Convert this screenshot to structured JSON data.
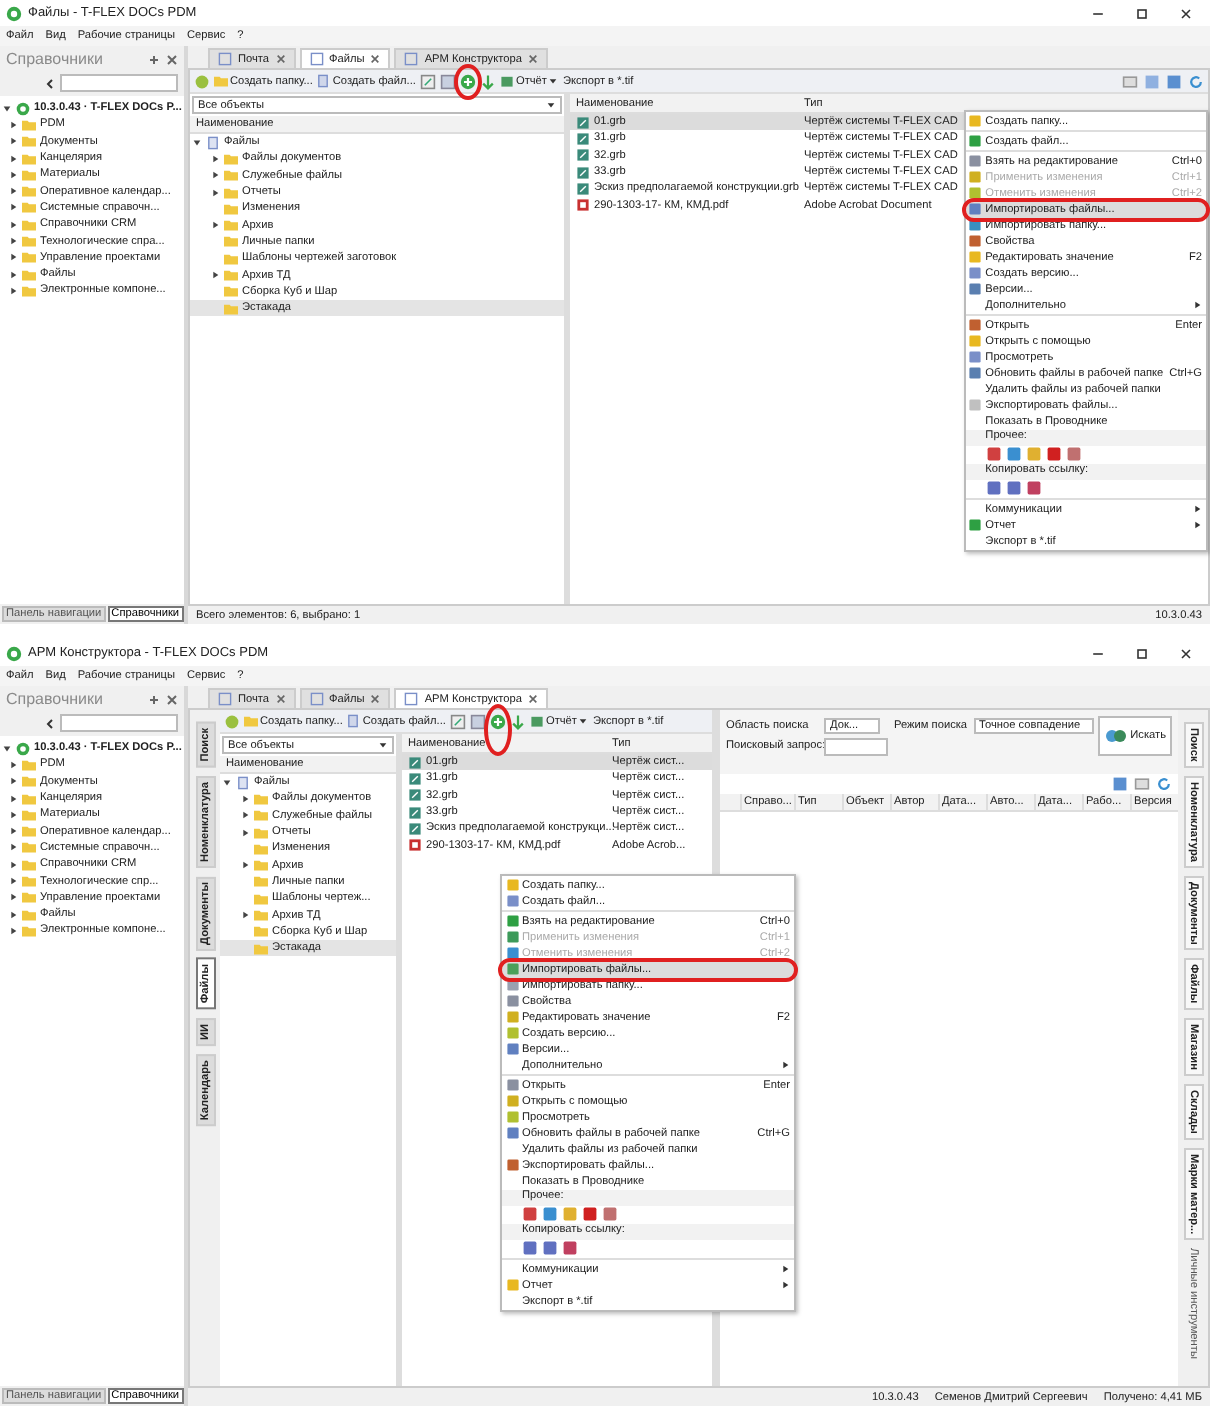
{
  "screens": [
    {
      "title": "Файлы - T-FLEX DOCs PDM",
      "menu": [
        "Файл",
        "Вид",
        "Рабочие страницы",
        "Сервис",
        "?"
      ],
      "nav": {
        "title": "Справочники",
        "root": "10.3.0.43 · T-FLEX DOCs P...",
        "items": [
          "PDM",
          "Документы",
          "Канцелярия",
          "Материалы",
          "Оперативное календар...",
          "Системные справочн...",
          "Справочники CRM",
          "Технологические спра...",
          "Управление проектами",
          "Файлы",
          "Электронные компоне..."
        ],
        "bottom_tabs": [
          {
            "label": "Панель навигации",
            "selected": false
          },
          {
            "label": "Справочники",
            "selected": true
          }
        ]
      },
      "tabs": [
        {
          "label": "Почта",
          "selected": false
        },
        {
          "label": "Файлы",
          "selected": true
        },
        {
          "label": "АРМ Конструктора",
          "selected": false
        }
      ],
      "toolbar": {
        "create_folder": "Создать папку...",
        "create_file": "Создать файл...",
        "report": "Отчёт",
        "export": "Экспорт в *.tif",
        "import_annotated": true
      },
      "filter": "Все объекты",
      "tree": {
        "column": "Наименование",
        "root": "Файлы",
        "children": [
          {
            "label": "Файлы документов",
            "expandable": true,
            "selected": false
          },
          {
            "label": "Служебные файлы",
            "expandable": true,
            "selected": false
          },
          {
            "label": "Отчеты",
            "expandable": true,
            "selected": false
          },
          {
            "label": "Изменения",
            "expandable": false,
            "selected": false
          },
          {
            "label": "Архив",
            "expandable": true,
            "selected": false
          },
          {
            "label": "Личные папки",
            "expandable": false,
            "selected": false
          },
          {
            "label": "Шаблоны чертежей заготовок",
            "expandable": false,
            "selected": false
          },
          {
            "label": "Архив ТД",
            "expandable": true,
            "selected": false
          },
          {
            "label": "Сборка Куб и Шар",
            "expandable": false,
            "selected": false
          },
          {
            "label": "Эстакада",
            "expandable": false,
            "selected": true
          }
        ]
      },
      "files": {
        "columns": [
          "Наименование",
          "Тип"
        ],
        "rows": [
          {
            "name": "01.grb",
            "type": "Чертёж системы T-FLEX CAD",
            "kind": "grb",
            "selected": true
          },
          {
            "name": "31.grb",
            "type": "Чертёж системы T-FLEX CAD",
            "kind": "grb",
            "selected": false
          },
          {
            "name": "32.grb",
            "type": "Чертёж системы T-FLEX CAD",
            "kind": "grb",
            "selected": false
          },
          {
            "name": "33.grb",
            "type": "Чертёж системы T-FLEX CAD",
            "kind": "grb",
            "selected": false
          },
          {
            "name": "Эскиз предполагаемой конструкции.grb",
            "type": "Чертёж системы T-FLEX CAD",
            "kind": "grb",
            "selected": false
          },
          {
            "name": "290-1303-17- КМ, КМД.pdf",
            "type": "Adobe Acrobat Document",
            "kind": "pdf",
            "selected": false
          }
        ]
      },
      "context_menu": {
        "sections": [
          [
            {
              "kind": "item",
              "label": "Создать папку...",
              "has_icon": true,
              "disabled": false,
              "selected": false
            }
          ],
          [
            {
              "kind": "item",
              "label": "Создать файл...",
              "has_icon": true,
              "disabled": false,
              "selected": false
            }
          ],
          [
            {
              "kind": "item",
              "label": "Взять на редактирование",
              "shortcut": "Ctrl+0",
              "has_icon": true,
              "disabled": false,
              "selected": false
            },
            {
              "kind": "item",
              "label": "Применить изменения",
              "shortcut": "Ctrl+1",
              "has_icon": true,
              "disabled": true,
              "selected": false
            },
            {
              "kind": "item",
              "label": "Отменить изменения",
              "shortcut": "Ctrl+2",
              "has_icon": true,
              "disabled": true,
              "selected": false
            },
            {
              "kind": "item",
              "label": "Импортировать файлы...",
              "has_icon": true,
              "disabled": false,
              "selected": true
            },
            {
              "kind": "item",
              "label": "Импортировать папку...",
              "has_icon": true,
              "disabled": false,
              "selected": false
            },
            {
              "kind": "item",
              "label": "Свойства",
              "has_icon": true,
              "disabled": false,
              "selected": false
            },
            {
              "kind": "item",
              "label": "Редактировать значение",
              "shortcut": "F2",
              "has_icon": true,
              "disabled": false,
              "selected": false
            },
            {
              "kind": "item",
              "label": "Создать версию...",
              "has_icon": true,
              "disabled": false,
              "selected": false
            },
            {
              "kind": "item",
              "label": "Версии...",
              "has_icon": true,
              "disabled": false,
              "selected": false
            },
            {
              "kind": "item",
              "label": "Дополнительно",
              "has_icon": false,
              "disabled": false,
              "selected": false,
              "submenu": true
            }
          ],
          [
            {
              "kind": "item",
              "label": "Открыть",
              "shortcut": "Enter",
              "has_icon": true,
              "disabled": false,
              "selected": false
            },
            {
              "kind": "item",
              "label": "Открыть с помощью",
              "has_icon": true,
              "disabled": false,
              "selected": false
            },
            {
              "kind": "item",
              "label": "Просмотреть",
              "has_icon": true,
              "disabled": false,
              "selected": false
            },
            {
              "kind": "item",
              "label": "Обновить файлы в рабочей папке",
              "shortcut": "Ctrl+G",
              "has_icon": true,
              "disabled": false,
              "selected": false
            },
            {
              "kind": "item",
              "label": "Удалить файлы из рабочей папки",
              "has_icon": false,
              "disabled": false,
              "selected": false
            },
            {
              "kind": "item",
              "label": "Экспортировать файлы...",
              "has_icon": true,
              "disabled": false,
              "selected": false
            },
            {
              "kind": "item",
              "label": "Показать в Проводнике",
              "has_icon": false,
              "disabled": false,
              "selected": false
            },
            {
              "kind": "header",
              "label": "Прочее:"
            },
            {
              "kind": "icons"
            },
            {
              "kind": "header",
              "label": "Копировать ссылку:"
            },
            {
              "kind": "icons"
            }
          ],
          [
            {
              "kind": "item",
              "label": "Коммуникации",
              "has_icon": false,
              "disabled": false,
              "selected": false,
              "submenu": true
            },
            {
              "kind": "item",
              "label": "Отчет",
              "has_icon": true,
              "disabled": false,
              "selected": false,
              "submenu": true
            },
            {
              "kind": "item",
              "label": "Экспорт в *.tif",
              "has_icon": false,
              "disabled": false,
              "selected": false
            }
          ]
        ]
      },
      "status": [
        "Всего элементов: 6, выбрано: 1",
        "10.3.0.43"
      ]
    },
    {
      "title": "АРМ Конструктора - T-FLEX DOCs PDM",
      "menu": [
        "Файл",
        "Вид",
        "Рабочие страницы",
        "Сервис",
        "?"
      ],
      "nav": {
        "title": "Справочники",
        "root": "10.3.0.43 · T-FLEX DOCs P...",
        "items": [
          "PDM",
          "Документы",
          "Канцелярия",
          "Материалы",
          "Оперативное календар...",
          "Системные справочн...",
          "Справочники CRM",
          "Технологические спр...",
          "Управление проектами",
          "Файлы",
          "Электронные компоне..."
        ],
        "bottom_tabs": [
          {
            "label": "Панель навигации",
            "selected": false
          },
          {
            "label": "Справочники",
            "selected": true
          }
        ]
      },
      "tabs": [
        {
          "label": "Почта",
          "selected": false
        },
        {
          "label": "Файлы",
          "selected": false
        },
        {
          "label": "АРМ Конструктора",
          "selected": true
        }
      ],
      "left_tabs": [
        {
          "label": "Поиск",
          "selected": false
        },
        {
          "label": "Номенклатура",
          "selected": false
        },
        {
          "label": "Документы",
          "selected": false
        },
        {
          "label": "Файлы",
          "selected": true
        },
        {
          "label": "ИИ",
          "selected": false
        },
        {
          "label": "Календарь",
          "selected": false
        }
      ],
      "toolbar": {
        "create_folder": "Создать папку...",
        "create_file": "Создать файл...",
        "report": "Отчёт",
        "export": "Экспорт в *.tif",
        "import_annotated": true
      },
      "filter": "Все объекты",
      "tree": {
        "column": "Наименование",
        "root": "Файлы",
        "children": [
          {
            "label": "Файлы документов",
            "expandable": true,
            "selected": false
          },
          {
            "label": "Служебные файлы",
            "expandable": true,
            "selected": false
          },
          {
            "label": "Отчеты",
            "expandable": true,
            "selected": false
          },
          {
            "label": "Изменения",
            "expandable": false,
            "selected": false
          },
          {
            "label": "Архив",
            "expandable": true,
            "selected": false
          },
          {
            "label": "Личные папки",
            "expandable": false,
            "selected": false
          },
          {
            "label": "Шаблоны чертеж...",
            "expandable": false,
            "selected": false
          },
          {
            "label": "Архив ТД",
            "expandable": true,
            "selected": false
          },
          {
            "label": "Сборка Куб и Шар",
            "expandable": false,
            "selected": false
          },
          {
            "label": "Эстакада",
            "expandable": false,
            "selected": true
          }
        ]
      },
      "files": {
        "columns": [
          "Наименование",
          "Тип"
        ],
        "rows": [
          {
            "name": "01.grb",
            "type": "Чертёж сист...",
            "kind": "grb",
            "selected": true
          },
          {
            "name": "31.grb",
            "type": "Чертёж сист...",
            "kind": "grb",
            "selected": false
          },
          {
            "name": "32.grb",
            "type": "Чертёж сист...",
            "kind": "grb",
            "selected": false
          },
          {
            "name": "33.grb",
            "type": "Чертёж сист...",
            "kind": "grb",
            "selected": false
          },
          {
            "name": "Эскиз предполагаемой конструкци...",
            "type": "Чертёж сист...",
            "kind": "grb",
            "selected": false
          },
          {
            "name": "290-1303-17- КМ, КМД.pdf",
            "type": "Adobe Acrob...",
            "kind": "pdf",
            "selected": false
          }
        ]
      },
      "search": {
        "area_label": "Область поиска",
        "area_value": "Док...",
        "mode_label": "Режим поиска",
        "mode_value": "Точное совпадение",
        "query_label": "Поисковый запрос:",
        "button": "Искать",
        "columns": [
          "Справо...",
          "Тип",
          "Объект",
          "Автор",
          "Дата...",
          "Авто...",
          "Дата...",
          "Рабо...",
          "Версия"
        ]
      },
      "right_tabs": [
        {
          "label": "Поиск"
        },
        {
          "label": "Номенклатура"
        },
        {
          "label": "Документы"
        },
        {
          "label": "Файлы"
        },
        {
          "label": "Магазин"
        },
        {
          "label": "Склады"
        },
        {
          "label": "Марки матер..."
        }
      ],
      "right_title": "Личные инструменты",
      "context_menu": {
        "sections": [
          [
            {
              "kind": "item",
              "label": "Создать папку...",
              "has_icon": true,
              "disabled": false,
              "selected": false
            },
            {
              "kind": "item",
              "label": "Создать файл...",
              "has_icon": true,
              "disabled": false,
              "selected": false
            }
          ],
          [
            {
              "kind": "item",
              "label": "Взять на редактирование",
              "shortcut": "Ctrl+0",
              "has_icon": true,
              "disabled": false,
              "selected": false
            },
            {
              "kind": "item",
              "label": "Применить изменения",
              "shortcut": "Ctrl+1",
              "has_icon": true,
              "disabled": true,
              "selected": false
            },
            {
              "kind": "item",
              "label": "Отменить изменения",
              "shortcut": "Ctrl+2",
              "has_icon": true,
              "disabled": true,
              "selected": false
            },
            {
              "kind": "item",
              "label": "Импортировать файлы...",
              "has_icon": true,
              "disabled": false,
              "selected": true
            },
            {
              "kind": "item",
              "label": "Импортировать папку...",
              "has_icon": true,
              "disabled": false,
              "selected": false
            },
            {
              "kind": "item",
              "label": "Свойства",
              "has_icon": true,
              "disabled": false,
              "selected": false
            },
            {
              "kind": "item",
              "label": "Редактировать значение",
              "shortcut": "F2",
              "has_icon": true,
              "disabled": false,
              "selected": false
            },
            {
              "kind": "item",
              "label": "Создать версию...",
              "has_icon": true,
              "disabled": false,
              "selected": false
            },
            {
              "kind": "item",
              "label": "Версии...",
              "has_icon": true,
              "disabled": false,
              "selected": false
            },
            {
              "kind": "item",
              "label": "Дополнительно",
              "has_icon": false,
              "disabled": false,
              "selected": false,
              "submenu": true
            }
          ],
          [
            {
              "kind": "item",
              "label": "Открыть",
              "shortcut": "Enter",
              "has_icon": true,
              "disabled": false,
              "selected": false
            },
            {
              "kind": "item",
              "label": "Открыть с помощью",
              "has_icon": true,
              "disabled": false,
              "selected": false
            },
            {
              "kind": "item",
              "label": "Просмотреть",
              "has_icon": true,
              "disabled": false,
              "selected": false
            },
            {
              "kind": "item",
              "label": "Обновить файлы в рабочей папке",
              "shortcut": "Ctrl+G",
              "has_icon": true,
              "disabled": false,
              "selected": false
            },
            {
              "kind": "item",
              "label": "Удалить файлы из рабочей папки",
              "has_icon": false,
              "disabled": false,
              "selected": false
            },
            {
              "kind": "item",
              "label": "Экспортировать файлы...",
              "has_icon": true,
              "disabled": false,
              "selected": false
            },
            {
              "kind": "item",
              "label": "Показать в Проводнике",
              "has_icon": false,
              "disabled": false,
              "selected": false
            },
            {
              "kind": "header",
              "label": "Прочее:"
            },
            {
              "kind": "icons"
            },
            {
              "kind": "header",
              "label": "Копировать ссылку:"
            },
            {
              "kind": "icons"
            }
          ],
          [
            {
              "kind": "item",
              "label": "Коммуникации",
              "has_icon": false,
              "disabled": false,
              "selected": false,
              "submenu": true
            },
            {
              "kind": "item",
              "label": "Отчет",
              "has_icon": true,
              "disabled": false,
              "selected": false,
              "submenu": true
            },
            {
              "kind": "item",
              "label": "Экспорт в *.tif",
              "has_icon": false,
              "disabled": false,
              "selected": false
            }
          ]
        ]
      },
      "status": [
        "10.3.0.43",
        "Семенов Дмитрий Сергеевич",
        "Получено: 4,41 МБ"
      ]
    }
  ]
}
